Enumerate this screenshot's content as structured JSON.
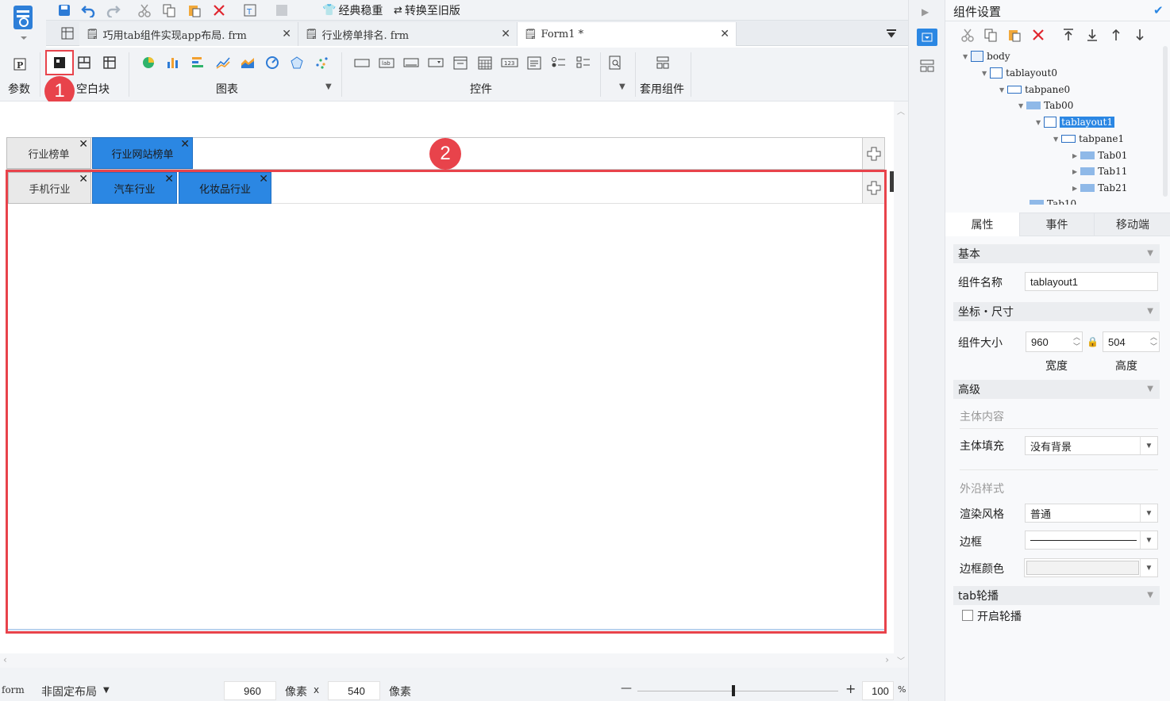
{
  "toolbar": {
    "classic_label": "经典稳重",
    "convert_label": "转换至旧版"
  },
  "doc_tabs": [
    {
      "label": "巧用tab组件实现app布局. frm"
    },
    {
      "label": "行业榜单排名. frm"
    },
    {
      "label": "Form1 *"
    }
  ],
  "ribbon": {
    "param_label": "参数",
    "blank_label": "空白块",
    "chart_label": "图表",
    "control_label": "控件",
    "template_label": "套用组件"
  },
  "annotations": {
    "one": "1",
    "two": "2"
  },
  "outer_tabs": [
    {
      "label": "行业榜单"
    },
    {
      "label": "行业网站榜单"
    }
  ],
  "inner_tabs": [
    {
      "label": "手机行业"
    },
    {
      "label": "汽车行业"
    },
    {
      "label": "化妆品行业"
    }
  ],
  "panel": {
    "title": "组件设置",
    "tree": [
      {
        "label": "body"
      },
      {
        "label": "tablayout0"
      },
      {
        "label": "tabpane0"
      },
      {
        "label": "Tab00"
      },
      {
        "label": "tablayout1"
      },
      {
        "label": "tabpane1"
      },
      {
        "label": "Tab01"
      },
      {
        "label": "Tab11"
      },
      {
        "label": "Tab21"
      },
      {
        "label": "Tab10"
      }
    ],
    "tabs": [
      "属性",
      "事件",
      "移动端"
    ],
    "section_basic": "基本",
    "name_label": "组件名称",
    "name_value": "tablayout1",
    "section_coord": "坐标・尺寸",
    "size_label": "组件大小",
    "width_value": "960",
    "height_value": "504",
    "width_label": "宽度",
    "height_label": "高度",
    "section_adv": "高级",
    "body_content": "主体内容",
    "body_fill_label": "主体填充",
    "body_fill_value": "没有背景",
    "outer_style": "外沿样式",
    "render_label": "渲染风格",
    "render_value": "普通",
    "border_label": "边框",
    "border_color_label": "边框颜色",
    "section_carousel": "tab轮播",
    "carousel_check": "开启轮播"
  },
  "status": {
    "form": "form",
    "layout": "非固定布局",
    "width": "960",
    "unit1": "像素",
    "x": "x",
    "height": "540",
    "unit2": "像素",
    "minus": "—",
    "plus": "+",
    "zoom": "100",
    "pct": "%"
  },
  "colors": {
    "accent": "#2b87e3",
    "highlight": "#e8434b"
  }
}
